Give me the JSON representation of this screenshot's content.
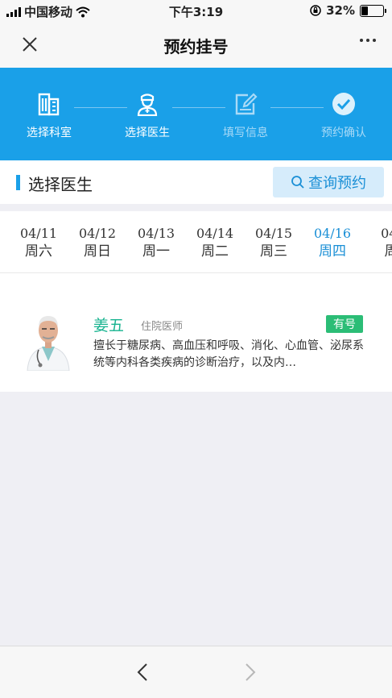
{
  "status_bar": {
    "carrier": "中国移动",
    "time": "下午3:19",
    "battery": "32%",
    "battery_level": 0.32
  },
  "nav": {
    "title": "预约挂号"
  },
  "steps": [
    {
      "label": "选择科室",
      "icon": "building-icon",
      "state": "done"
    },
    {
      "label": "选择医生",
      "icon": "doctor-icon",
      "state": "current"
    },
    {
      "label": "填写信息",
      "icon": "edit-icon",
      "state": "pending"
    },
    {
      "label": "预约确认",
      "icon": "check-circle-icon",
      "state": "pending"
    }
  ],
  "section": {
    "title": "选择医生",
    "query_button": "查询预约"
  },
  "dates": [
    {
      "date": "04/11",
      "weekday": "周六"
    },
    {
      "date": "04/12",
      "weekday": "周日"
    },
    {
      "date": "04/13",
      "weekday": "周一"
    },
    {
      "date": "04/14",
      "weekday": "周二"
    },
    {
      "date": "04/15",
      "weekday": "周三"
    },
    {
      "date": "04/16",
      "weekday": "周四",
      "selected": true
    },
    {
      "date": "04/",
      "weekday": "周"
    }
  ],
  "doctor": {
    "name": "姜五",
    "title": "住院医师",
    "availability": "有号",
    "description": "擅长于糖尿病、高血压和呼吸、消化、心血管、泌尿系统等内科各类疾病的诊断治疗，以及内…"
  },
  "colors": {
    "primary": "#1aa0e8",
    "accent_text": "#1a8fd6",
    "doctor_name": "#17b38f",
    "badge": "#2bbd76"
  }
}
